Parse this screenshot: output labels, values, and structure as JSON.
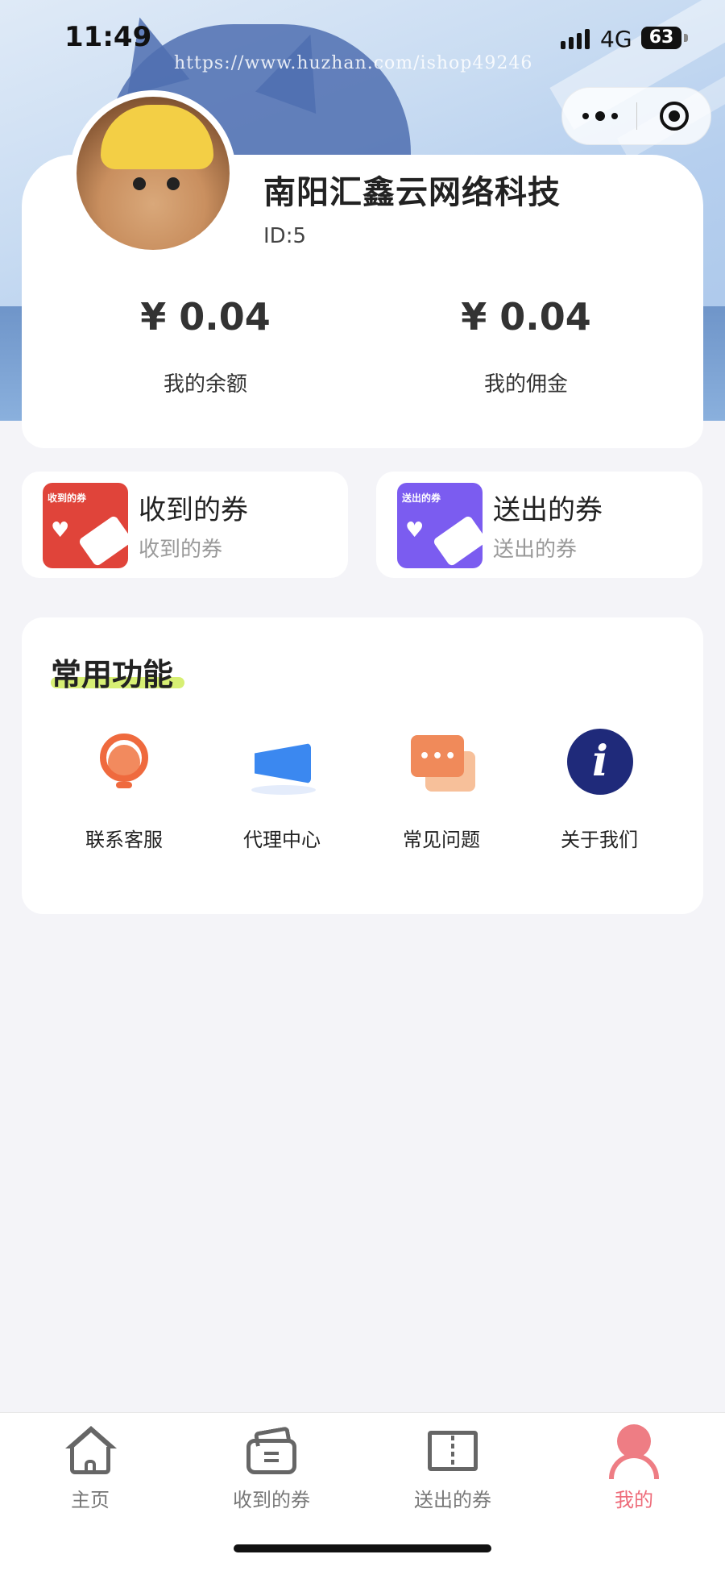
{
  "status_bar": {
    "time": "11:49",
    "network": "4G",
    "battery": "63"
  },
  "watermark": "https://www.huzhan.com/ishop49246",
  "profile": {
    "name": "南阳汇鑫云网络科技",
    "id_text": "ID:5",
    "balance_value": "¥ 0.04",
    "balance_label": "我的余额",
    "commission_value": "¥ 0.04",
    "commission_label": "我的佣金"
  },
  "coupons": [
    {
      "badge": "收到的券",
      "title": "收到的券",
      "subtitle": "收到的券"
    },
    {
      "badge": "送出的券",
      "title": "送出的券",
      "subtitle": "送出的券"
    }
  ],
  "functions": {
    "title": "常用功能",
    "items": [
      {
        "label": "联系客服",
        "icon": "customer-service-icon"
      },
      {
        "label": "代理中心",
        "icon": "megaphone-icon"
      },
      {
        "label": "常见问题",
        "icon": "chat-bubbles-icon"
      },
      {
        "label": "关于我们",
        "icon": "info-icon"
      }
    ]
  },
  "tabbar": {
    "items": [
      {
        "label": "主页",
        "icon": "home-icon"
      },
      {
        "label": "收到的券",
        "icon": "wallet-icon"
      },
      {
        "label": "送出的券",
        "icon": "ticket-icon"
      },
      {
        "label": "我的",
        "icon": "user-icon"
      }
    ],
    "active_index": 3,
    "active_color": "#ee6c7a"
  },
  "colors": {
    "received_coupon": "#e0443a",
    "sent_coupon": "#7b5cf0",
    "title_highlight": "#d7ef74"
  }
}
